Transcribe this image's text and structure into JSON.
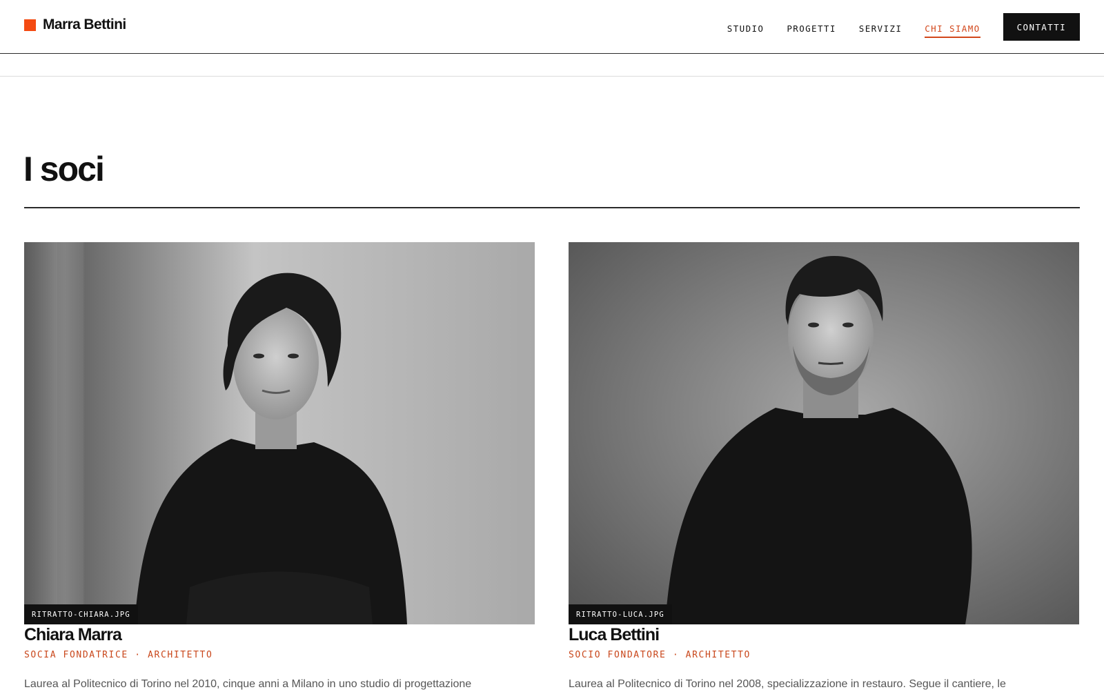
{
  "brand": {
    "name": "Marra Bettini",
    "accent": "#f44a12"
  },
  "nav": {
    "items": [
      {
        "label": "STUDIO",
        "active": false
      },
      {
        "label": "PROGETTI",
        "active": false
      },
      {
        "label": "SERVIZI",
        "active": false
      },
      {
        "label": "CHI SIAMO",
        "active": true
      }
    ],
    "cta_label": "CONTATTI"
  },
  "section": {
    "title": "I soci"
  },
  "partners": [
    {
      "photo_label": "RITRATTO-CHIARA.JPG",
      "photo_icon": "portrait-photo",
      "name": "Chiara Marra",
      "role": "SOCIA FONDATRICE · ARCHITETTO",
      "bio": "Laurea al Politecnico di Torino nel 2010, cinque anni a Milano in uno studio di progettazione"
    },
    {
      "photo_label": "RITRATTO-LUCA.JPG",
      "photo_icon": "portrait-photo",
      "name": "Luca Bettini",
      "role": "SOCIO FONDATORE · ARCHITETTO",
      "bio": "Laurea al Politecnico di Torino nel 2008, specializzazione in restauro. Segue il cantiere, le"
    }
  ],
  "colors": {
    "role_accent": "#c9471b",
    "text": "#111111",
    "cta_bg": "#111111"
  }
}
